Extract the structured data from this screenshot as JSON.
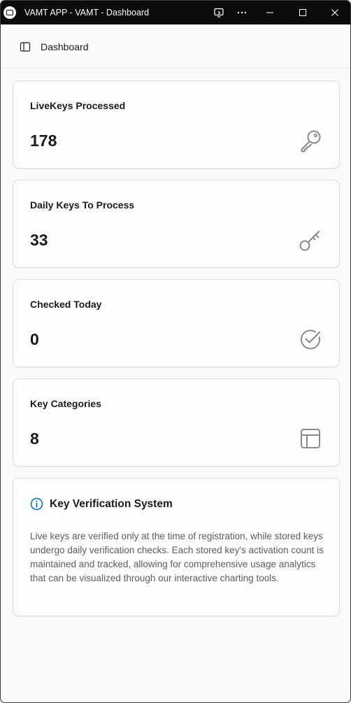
{
  "window": {
    "title": "VAMT APP - VAMT - Dashboard"
  },
  "titlebar_buttons": [
    "screen-cast-icon",
    "more-icon",
    "minimize-icon",
    "maximize-icon",
    "close-icon"
  ],
  "nav": {
    "toggle_icon": "sidebar-toggle-icon",
    "title": "Dashboard"
  },
  "stats": [
    {
      "label": "LiveKeys Processed",
      "value": "178",
      "icon": "key-icon"
    },
    {
      "label": "Daily Keys To Process",
      "value": "33",
      "icon": "key-outline-icon"
    },
    {
      "label": "Checked Today",
      "value": "0",
      "icon": "check-circle-icon"
    },
    {
      "label": "Key Categories",
      "value": "8",
      "icon": "table-icon"
    }
  ],
  "info": {
    "icon": "info-icon",
    "title": "Key Verification System",
    "body": "Live keys are verified only at the time of registration, while stored keys undergo daily verification checks. Each stored key's activation count is maintained and tracked, allowing for comprehensive usage analytics that can be visualized through our interactive charting tools."
  },
  "colors": {
    "titlebar": "#0c0c0c",
    "background": "#fafafa",
    "accent": "#0067c0",
    "icon_gray": "#8a8a8a"
  }
}
